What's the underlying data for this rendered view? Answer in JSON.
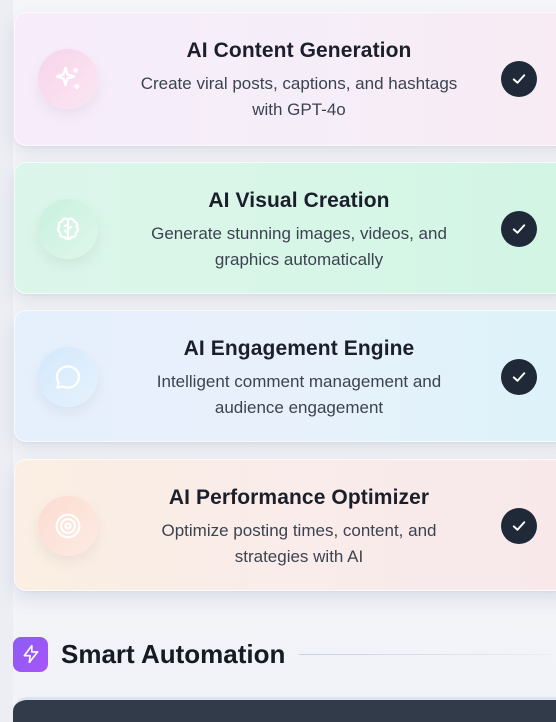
{
  "features": [
    {
      "title": "AI Content Generation",
      "desc_line1": "Create viral posts, captions, and hashtags",
      "desc_line2": "with GPT-4o",
      "icon": "sparkles-icon",
      "checked": true
    },
    {
      "title": "AI Visual Creation",
      "desc_line1": "Generate stunning images, videos, and",
      "desc_line2": "graphics automatically",
      "icon": "brain-icon",
      "checked": true
    },
    {
      "title": "AI Engagement Engine",
      "desc_line1": "Intelligent comment management and",
      "desc_line2": "audience engagement",
      "icon": "chat-bubble-icon",
      "checked": true
    },
    {
      "title": "AI Performance Optimizer",
      "desc_line1": "Optimize posting times, content, and",
      "desc_line2": "strategies with AI",
      "icon": "target-icon",
      "checked": true
    }
  ],
  "section": {
    "title": "Smart Automation",
    "icon": "lightning-bolt-icon"
  },
  "colors": {
    "check_bg": "#1f2937",
    "accent_purple": "#8b5cf6",
    "title_text": "#1b1f2a"
  }
}
